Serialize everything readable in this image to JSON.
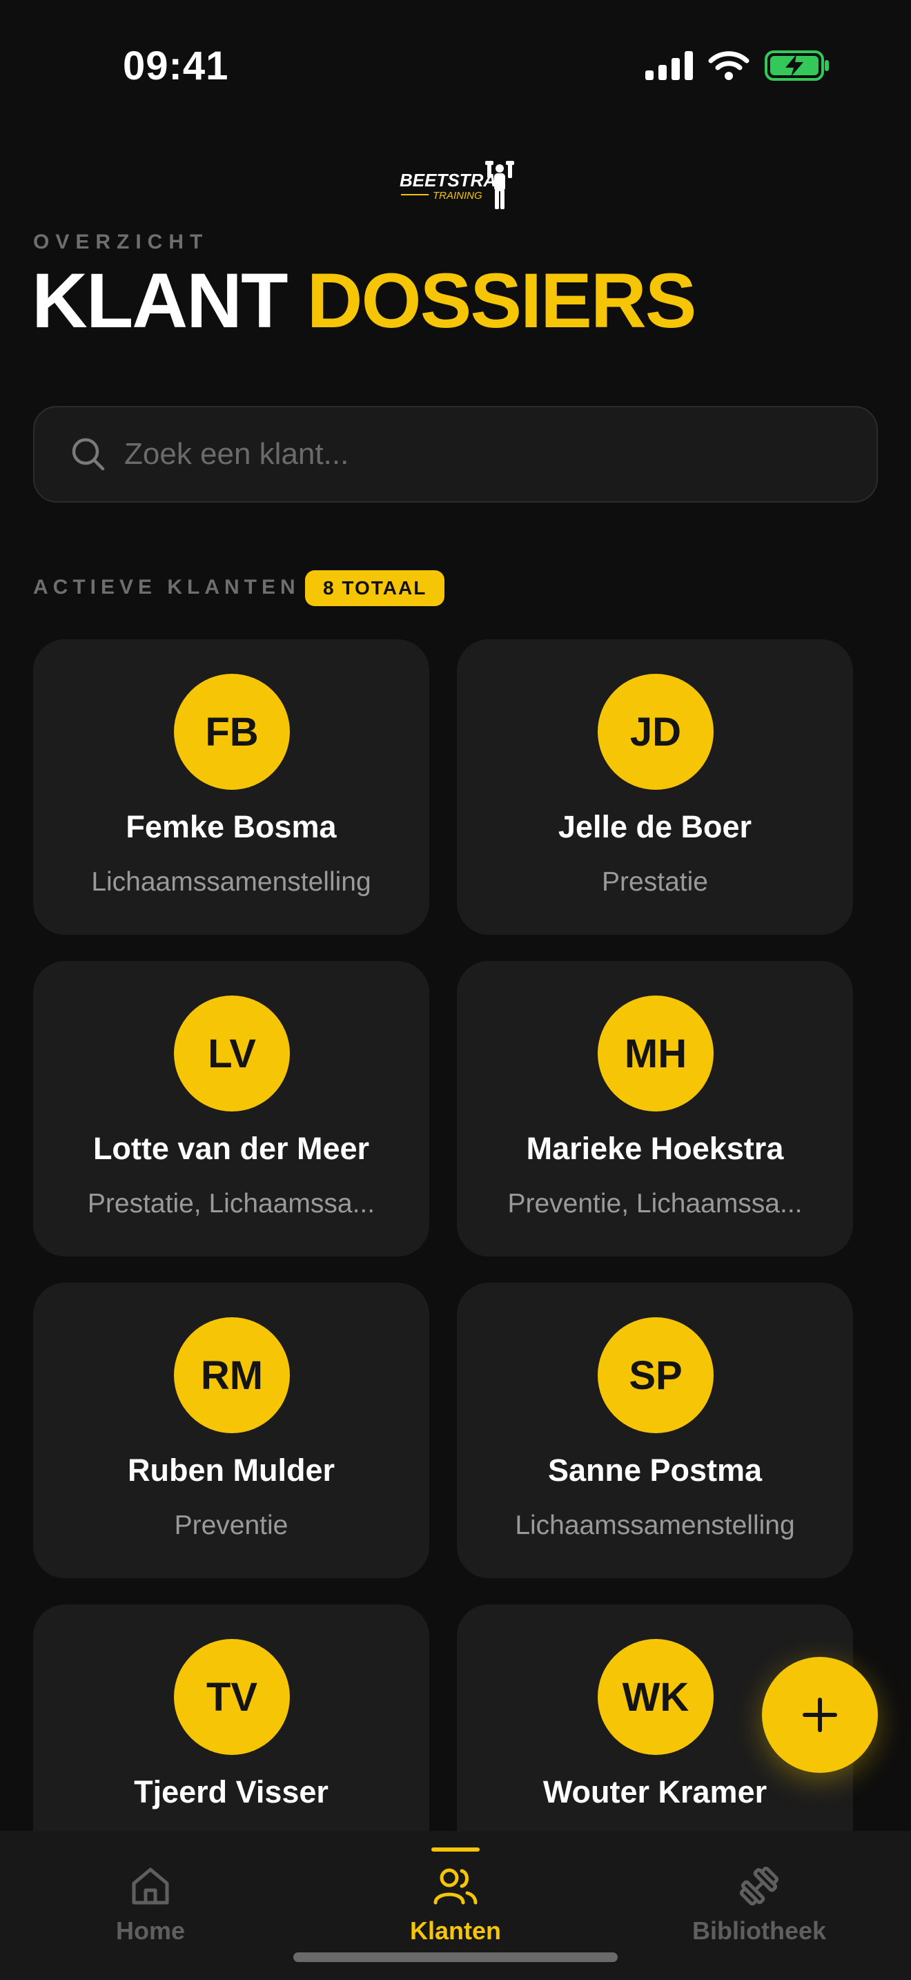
{
  "status_bar": {
    "time": "09:41"
  },
  "brand": {
    "logo_text": "BEETSTRA",
    "logo_subtext": "TRAINING"
  },
  "header": {
    "eyebrow": "OVERZICHT",
    "title_part1": "KLANT",
    "title_part2": "DOSSIERS"
  },
  "search": {
    "placeholder": "Zoek een klant...",
    "value": ""
  },
  "clients_section": {
    "label": "ACTIEVE KLANTEN",
    "badge": "8 TOTAAL"
  },
  "clients": [
    {
      "initials": "FB",
      "name": "Femke Bosma",
      "tags": "Lichaamssamenstelling"
    },
    {
      "initials": "JD",
      "name": "Jelle de Boer",
      "tags": "Prestatie"
    },
    {
      "initials": "LV",
      "name": "Lotte van der Meer",
      "tags": "Prestatie, Lichaamssa..."
    },
    {
      "initials": "MH",
      "name": "Marieke Hoekstra",
      "tags": "Preventie, Lichaamssa..."
    },
    {
      "initials": "RM",
      "name": "Ruben Mulder",
      "tags": "Preventie"
    },
    {
      "initials": "SP",
      "name": "Sanne Postma",
      "tags": "Lichaamssamenstelling"
    },
    {
      "initials": "TV",
      "name": "Tjeerd Visser",
      "tags": ""
    },
    {
      "initials": "WK",
      "name": "Wouter Kramer",
      "tags": ""
    }
  ],
  "tabbar": {
    "tabs": [
      {
        "label": "Home",
        "icon": "home-icon",
        "active": false
      },
      {
        "label": "Klanten",
        "icon": "users-icon",
        "active": true
      },
      {
        "label": "Bibliotheek",
        "icon": "dumbbell-icon",
        "active": false
      }
    ]
  },
  "colors": {
    "accent": "#f5c506",
    "background": "#0e0e0e",
    "card": "#1c1c1c",
    "battery": "#34c759"
  }
}
